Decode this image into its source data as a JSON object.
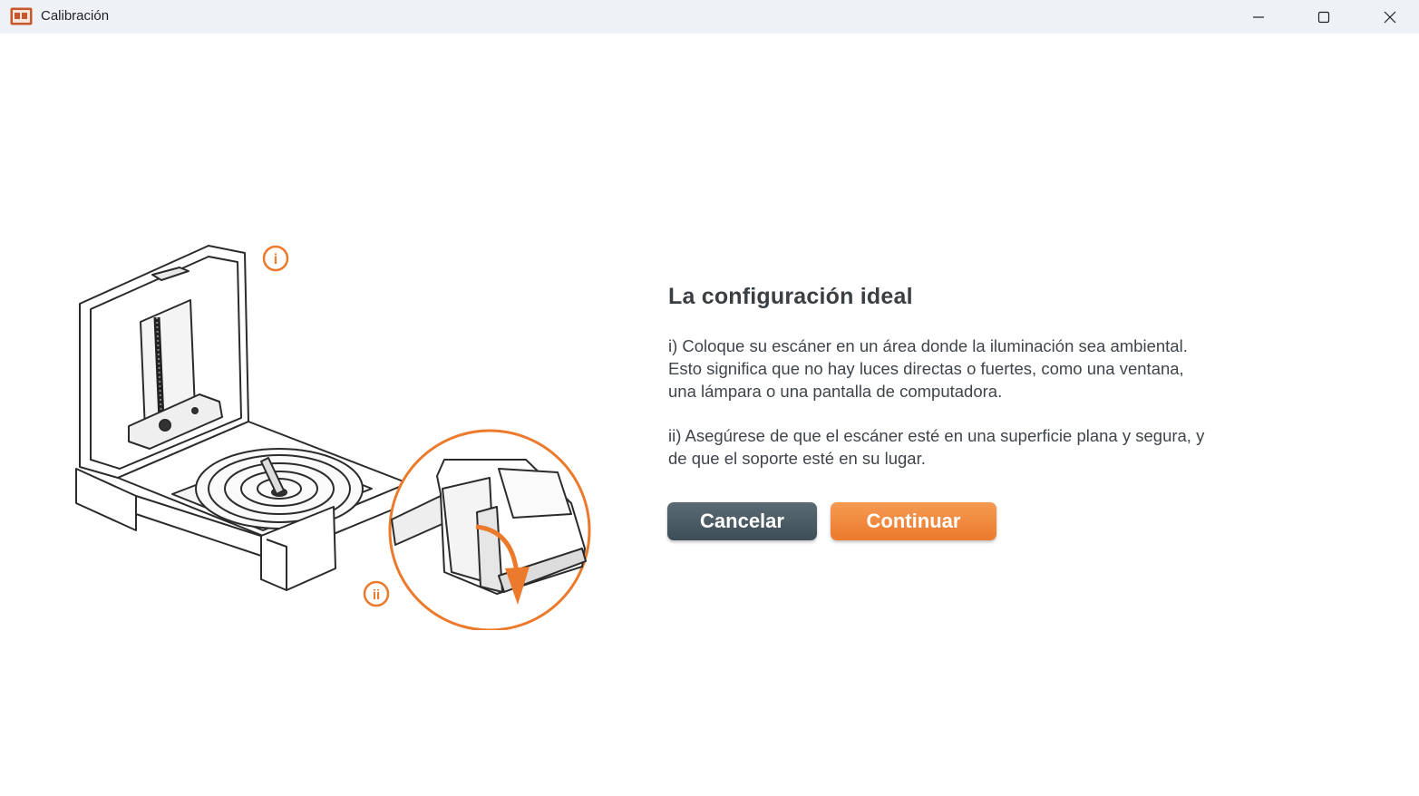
{
  "window": {
    "title": "Calibración",
    "app_icon": "matterform-app-icon",
    "controls": [
      "minimize-icon",
      "maximize-icon",
      "close-icon"
    ]
  },
  "illustration": {
    "marker_i": "i",
    "marker_ii": "ii",
    "accent_color": "#ec7a2c"
  },
  "content": {
    "heading": "La configuración ideal",
    "para1_line1": "i) Coloque su escáner en un área donde la iluminación sea ambiental.",
    "para1_line2": "Esto significa que no hay luces directas o fuertes, como una ventana,",
    "para1_line3": "una lámpara o una pantalla de computadora.",
    "para2_line1": "ii) Asegúrese de que el escáner esté en una superficie plana y segura, y",
    "para2_line2": "de que el soporte esté en su lugar."
  },
  "buttons": {
    "cancel_label": "Cancelar",
    "continue_label": "Continuar",
    "cancel_color": "#4b5a62",
    "continue_color": "#f08839"
  }
}
